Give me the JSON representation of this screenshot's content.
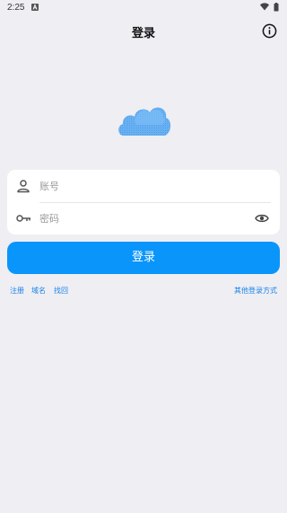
{
  "status_bar": {
    "time": "2:25",
    "notification_icon": "notification-a-icon",
    "wifi_icon": "wifi-icon",
    "battery_icon": "battery-icon"
  },
  "header": {
    "title": "登录",
    "info_icon": "info-icon"
  },
  "logo": {
    "icon": "cloud-icon",
    "color": "#5aa8f0"
  },
  "form": {
    "account": {
      "icon": "user-icon",
      "placeholder": "账号",
      "value": ""
    },
    "password": {
      "icon": "key-icon",
      "placeholder": "密码",
      "value": "",
      "toggle_icon": "eye-icon"
    }
  },
  "login_button": {
    "label": "登录",
    "color": "#0a95fb"
  },
  "links": {
    "register": "注册",
    "domain": "域名",
    "recover": "找回",
    "other_login": "其他登录方式",
    "color": "#1783e8"
  }
}
